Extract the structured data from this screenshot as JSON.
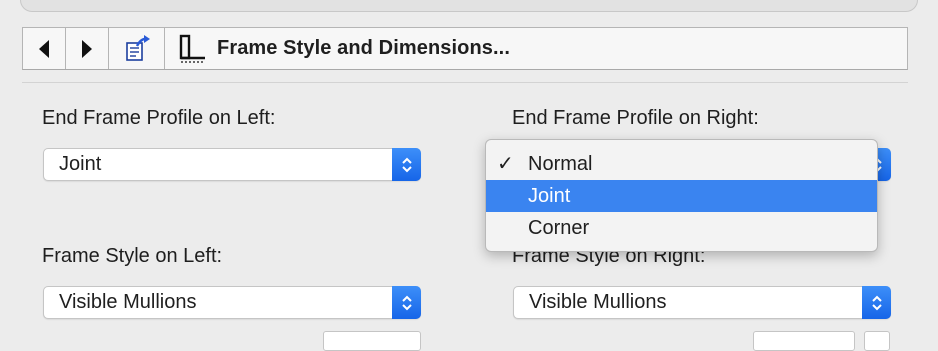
{
  "toolbar": {
    "back_icon": "triangle-left-icon",
    "forward_icon": "triangle-right-icon",
    "export_icon": "export-doc-icon",
    "frame_icon": "frame-dimensions-icon",
    "title": "Frame Style and Dimensions..."
  },
  "end_frame_left": {
    "label": "End Frame Profile on Left:",
    "value": "Joint"
  },
  "end_frame_right": {
    "label": "End Frame Profile on Right:",
    "menu": {
      "items": [
        "Normal",
        "Joint",
        "Corner"
      ],
      "checked": "Normal",
      "highlighted": "Joint",
      "check_mark": "✓"
    }
  },
  "frame_style_left": {
    "label": "Frame Style on Left:",
    "value": "Visible Mullions"
  },
  "frame_style_right": {
    "label": "Frame Style on Right:",
    "value": "Visible Mullions"
  },
  "colors": {
    "accent": "#3a84f0",
    "background": "#ececec"
  }
}
